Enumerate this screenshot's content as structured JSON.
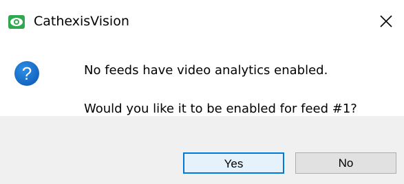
{
  "window": {
    "title": "CathexisVision",
    "app_icon": "cathexis-eye-icon",
    "close_icon": "close-icon",
    "accent_color": "#2fa84f"
  },
  "content": {
    "icon": "question-icon",
    "icon_glyph": "?",
    "message_line1": "No feeds have video analytics enabled.",
    "message_line2": "Would you like it to be enabled for feed #1?"
  },
  "buttons": {
    "yes_label": "Yes",
    "no_label": "No",
    "focus_color": "#0078d7"
  }
}
